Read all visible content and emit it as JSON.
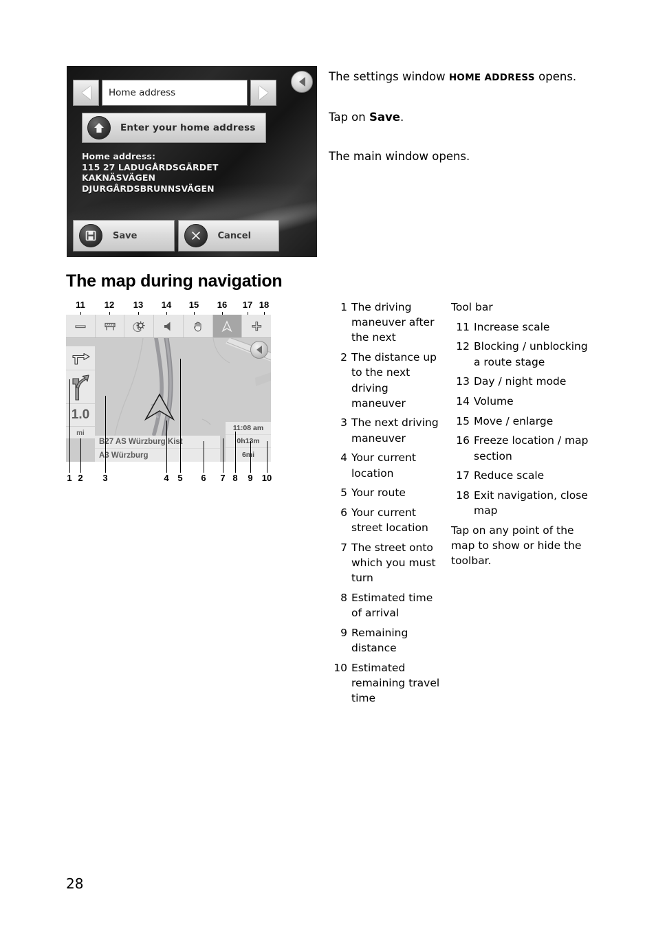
{
  "page": {
    "number": "28",
    "section_heading": "The map during navigation"
  },
  "home_screenshot": {
    "title_value": "Home address",
    "prev_icon": "triangle-left-icon",
    "next_icon": "triangle-right-icon",
    "back_icon": "back-circle-icon",
    "enter_button_label": "Enter your home address",
    "enter_button_icon": "home-icon",
    "address_label": "Home address:",
    "address_lines": [
      "115 27 LADUGÅRDSGÄRDET",
      "KAKNÄSVÄGEN",
      "DJURGÅRDSBRUNNSVÄGEN"
    ],
    "save_label": "Save",
    "save_icon": "floppy-disk-icon",
    "cancel_label": "Cancel",
    "cancel_icon": "cross-icon"
  },
  "instructions": [
    {
      "parts": [
        {
          "text": "The settings window ",
          "style": "normal"
        },
        {
          "text": "HOME ADDRESS",
          "style": "smallcaps-bold"
        },
        {
          "text": " opens.",
          "style": "normal"
        }
      ]
    },
    {
      "parts": [
        {
          "text": "Tap on ",
          "style": "normal"
        },
        {
          "text": "Save",
          "style": "bold"
        },
        {
          "text": ".",
          "style": "normal"
        }
      ]
    },
    {
      "parts": [
        {
          "text": "The main window opens.",
          "style": "normal"
        }
      ]
    }
  ],
  "map_screenshot": {
    "top_labels": [
      "11",
      "12",
      "13",
      "14",
      "15",
      "16",
      "17",
      "18"
    ],
    "bottom_labels": [
      "1",
      "2",
      "3",
      "4",
      "5",
      "6",
      "7",
      "8",
      "9",
      "10"
    ],
    "toolbar_icons": [
      "minus-icon",
      "road-barrier-icon",
      "day-night-icon",
      "speaker-icon",
      "hand-icon",
      "compass-arrow-icon",
      "plus-icon"
    ],
    "active_toolbar_index": 5,
    "back_icon": "back-circle-icon",
    "next_maneuver_icon": "turn-right-ahead-icon",
    "following_maneuver_icon": "merge-right-icon",
    "distance_value": "1.0",
    "distance_unit": "mi",
    "street_next": "B27 AS Würzburg Kist",
    "street_current": "A3 Würzburg",
    "arrival_time": "11:08 am",
    "remaining_time": "0h13m",
    "remaining_distance": "6mi"
  },
  "legend_left": [
    {
      "num": "1",
      "text": "The driving maneuver after the next"
    },
    {
      "num": "2",
      "text": "The distance up to the next driving maneuver"
    },
    {
      "num": "3",
      "text": "The next driving maneuver"
    },
    {
      "num": "4",
      "text": "Your current location"
    },
    {
      "num": "5",
      "text": "Your route"
    },
    {
      "num": "6",
      "text": "Your current street location"
    },
    {
      "num": "7",
      "text": "The street onto which you must turn"
    },
    {
      "num": "8",
      "text": "Estimated time of arrival"
    },
    {
      "num": "9",
      "text": "Remaining distance"
    },
    {
      "num": "10",
      "text": "Estimated remaining travel time"
    }
  ],
  "legend_right": {
    "title": "Tool bar",
    "items": [
      {
        "num": "11",
        "text": "Increase scale"
      },
      {
        "num": "12",
        "text": "Blocking / unblocking a route stage"
      },
      {
        "num": "13",
        "text": "Day / night mode"
      },
      {
        "num": "14",
        "text": "Volume"
      },
      {
        "num": "15",
        "text": "Move / enlarge"
      },
      {
        "num": "16",
        "text": "Freeze location / map section"
      },
      {
        "num": "17",
        "text": "Reduce scale"
      },
      {
        "num": "18",
        "text": "Exit navigation, close map"
      }
    ],
    "note": "Tap on any point of the map to show or hide the toolbar."
  },
  "colors": {
    "page_background": "#ffffff",
    "text": "#000000",
    "ui_panel": "#e9e9e9",
    "ui_button": "#dcdcdc",
    "toolbar_active": "#a6a6a6",
    "map_land": "#cccccc",
    "route": "#8f8f93"
  }
}
